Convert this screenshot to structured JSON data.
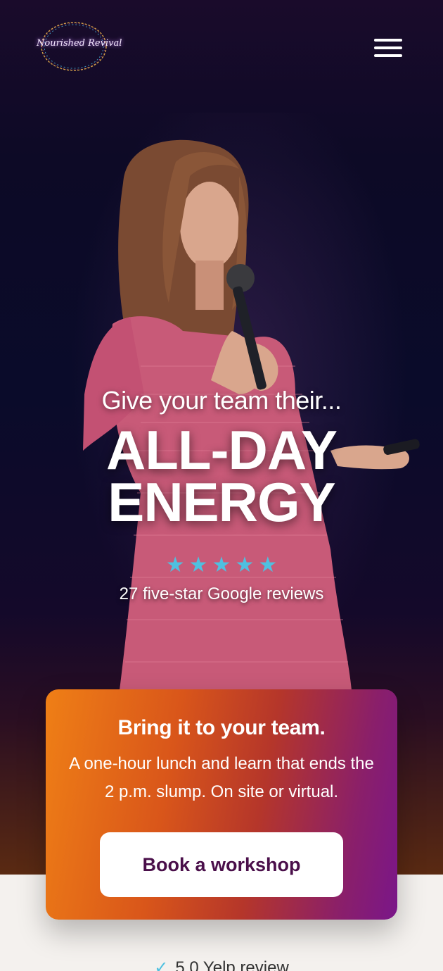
{
  "brand": {
    "logo_text": "Nourished Revival"
  },
  "header": {
    "menu_icon": "hamburger-menu-icon"
  },
  "hero": {
    "kicker": "Give your team their...",
    "headline_line1": "ALL-DAY",
    "headline_line2": "ENERGY",
    "rating_stars": 5,
    "star_icon": "star-icon",
    "reviews_text": "27 five-star Google reviews"
  },
  "card": {
    "title": "Bring it to your team.",
    "body": "A one-hour lunch and learn that ends the 2 p.m. slump. On site or virtual.",
    "cta_label": "Book a workshop"
  },
  "proof": {
    "check_icon": "check-icon",
    "yelp_text": "5.0 Yelp review"
  },
  "colors": {
    "accent_star": "#4fc0e0",
    "cta_text": "#4a0f4a",
    "card_gradient_start": "#ef7f16",
    "card_gradient_end": "#7a1689"
  }
}
